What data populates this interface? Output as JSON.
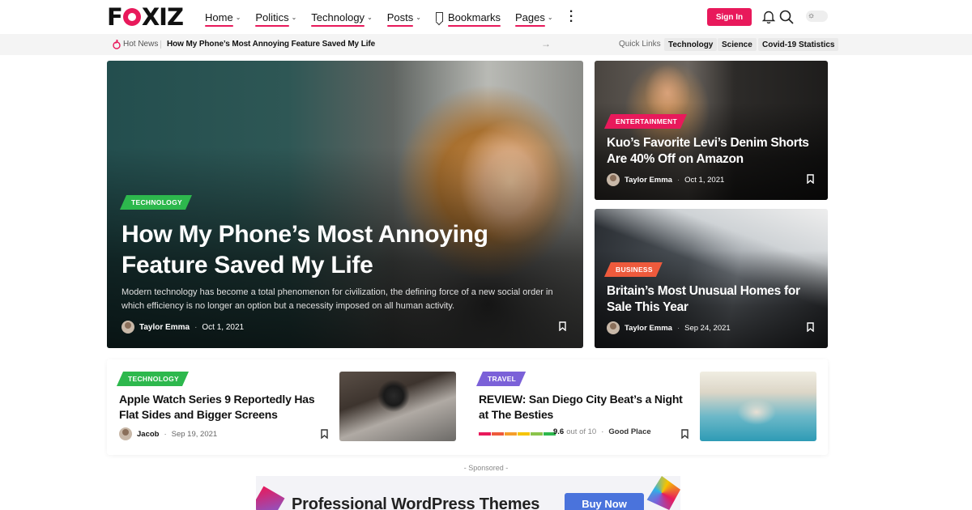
{
  "header": {
    "logo": "FOXIZ",
    "nav": [
      {
        "label": "Home",
        "dropdown": true,
        "underline": true
      },
      {
        "label": "Politics",
        "dropdown": true,
        "underline": true
      },
      {
        "label": "Technology",
        "dropdown": true,
        "underline": true
      },
      {
        "label": "Posts",
        "dropdown": true,
        "underline": true
      },
      {
        "label": "Bookmarks",
        "dropdown": false,
        "underline": true
      },
      {
        "label": "Pages",
        "dropdown": true,
        "underline": true
      }
    ],
    "signin_label": "Sign In",
    "icons": [
      "notification-bell-icon",
      "search-icon",
      "dark-mode-toggle"
    ]
  },
  "hotbar": {
    "label": "Hot News",
    "title": "How My Phone’s Most Annoying Feature Saved My Life",
    "arrow": "→",
    "quick_links_label": "Quick Links",
    "quick_links": [
      "Technology",
      "Science",
      "Covid-19 Statistics"
    ]
  },
  "hero": {
    "category": "TECHNOLOGY",
    "title": "How My Phone’s Most Annoying Feature Saved My Life",
    "excerpt": "Modern technology has become a total phenomenon for civilization, the defining force of a new social order in which efficiency is no longer an option but a necessity imposed on all human activity.",
    "author": "Taylor Emma",
    "date": "Oct 1, 2021"
  },
  "side_cards": [
    {
      "category": "ENTERTAINMENT",
      "title": "Kuo’s Favorite Levi’s Denim Shorts Are 40% Off on Amazon",
      "author": "Taylor Emma",
      "date": "Oct 1, 2021"
    },
    {
      "category": "BUSINESS",
      "title": "Britain’s Most Unusual Homes for Sale This Year",
      "author": "Taylor Emma",
      "date": "Sep 24, 2021"
    }
  ],
  "small_cards": [
    {
      "category": "TECHNOLOGY",
      "title": "Apple Watch Series 9 Reportedly Has Flat Sides and Bigger Screens",
      "author": "Jacob",
      "date": "Sep 19, 2021"
    },
    {
      "category": "TRAVEL",
      "title": "REVIEW: San Diego City Beat’s a Night at The Besties",
      "rating_score": "9.6",
      "rating_suffix": "out of 10",
      "rating_label": "Good Place",
      "rating_value": 0.96
    }
  ],
  "rating_colors": [
    "#e8195b",
    "#ee5a3c",
    "#f59e2b",
    "#f5c400",
    "#8bc34a",
    "#2db84d"
  ],
  "colors": {
    "accent": "#e8195b",
    "technology": "#2db84d",
    "entertainment": "#e8195b",
    "business": "#ee5a3c",
    "travel": "#7b61d8"
  },
  "sponsored": {
    "label": "- Sponsored -",
    "ad_title": "Professional WordPress Themes",
    "ad_button": "Buy Now"
  }
}
